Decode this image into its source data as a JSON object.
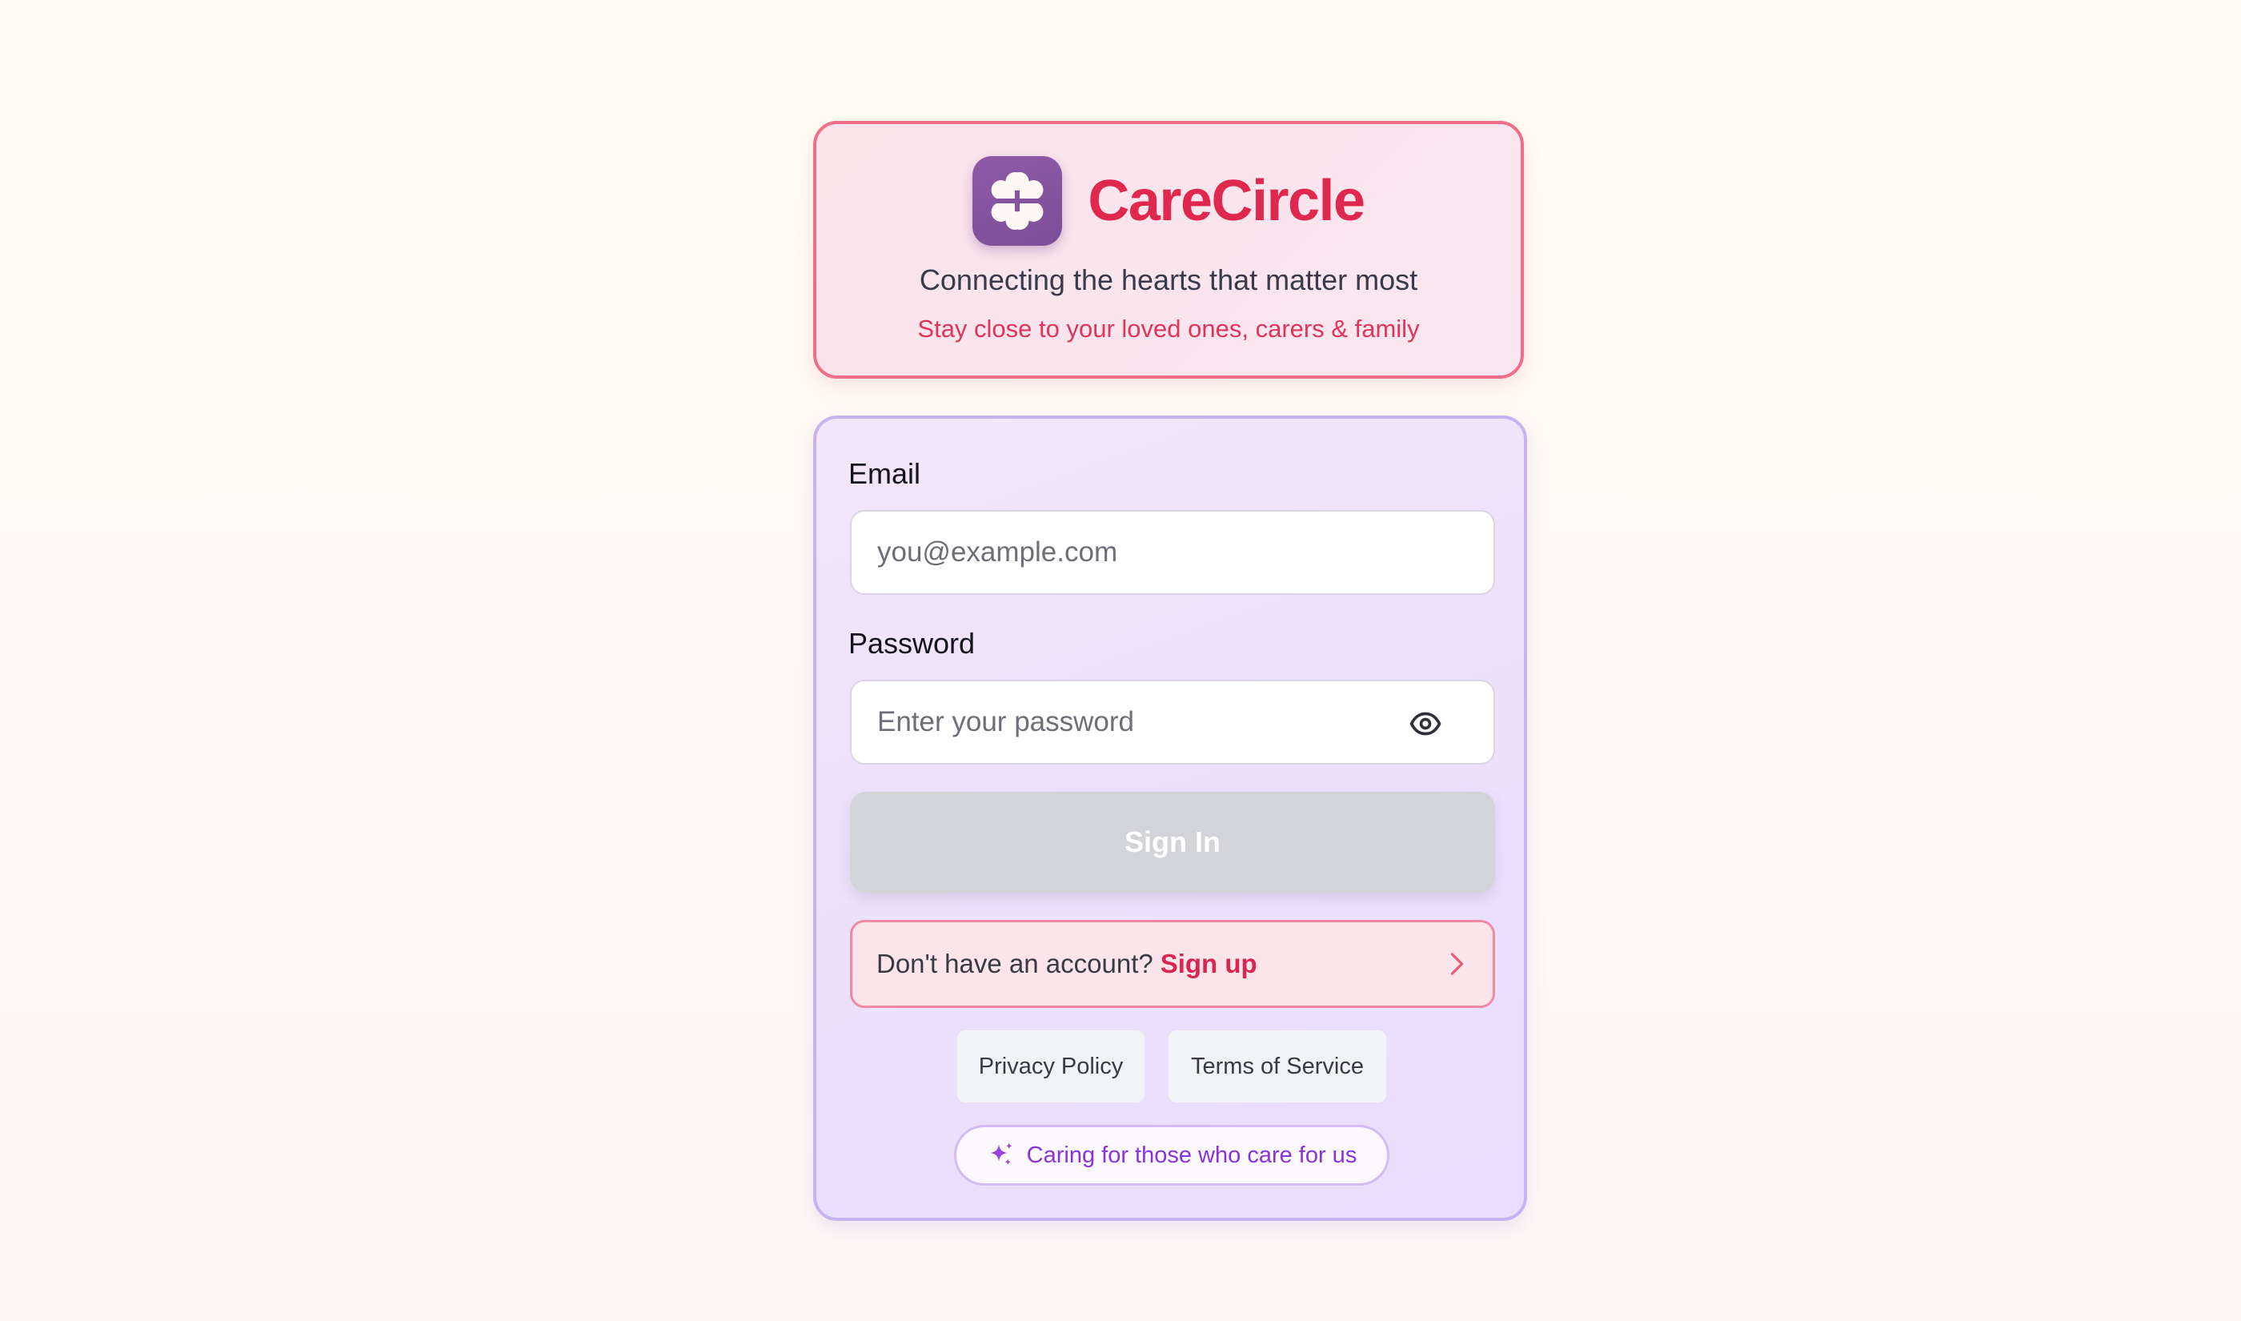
{
  "brand": {
    "name": "CareCircle",
    "tagline": "Connecting the hearts that matter most",
    "subtagline": "Stay close to your loved ones, carers & family",
    "logo_icon": "four-heart-clover-icon"
  },
  "form": {
    "email": {
      "label": "Email",
      "value": "",
      "placeholder": "you@example.com"
    },
    "password": {
      "label": "Password",
      "value": "",
      "placeholder": "Enter your password",
      "toggle_icon": "eye-icon"
    },
    "submit_label": "Sign In",
    "signup": {
      "prompt": "Don't have an account?",
      "link": "Sign up",
      "icon": "chevron-right-icon"
    },
    "links": {
      "privacy": "Privacy Policy",
      "terms": "Terms of Service"
    },
    "badge": {
      "text": "Caring for those who care for us",
      "icon": "sparkle-icon"
    }
  },
  "colors": {
    "brand_red": "#e0284f",
    "logo_purple": "#8d5aa8",
    "accent_violet": "#8a34d8",
    "disabled_button": "#d3d4d9"
  }
}
